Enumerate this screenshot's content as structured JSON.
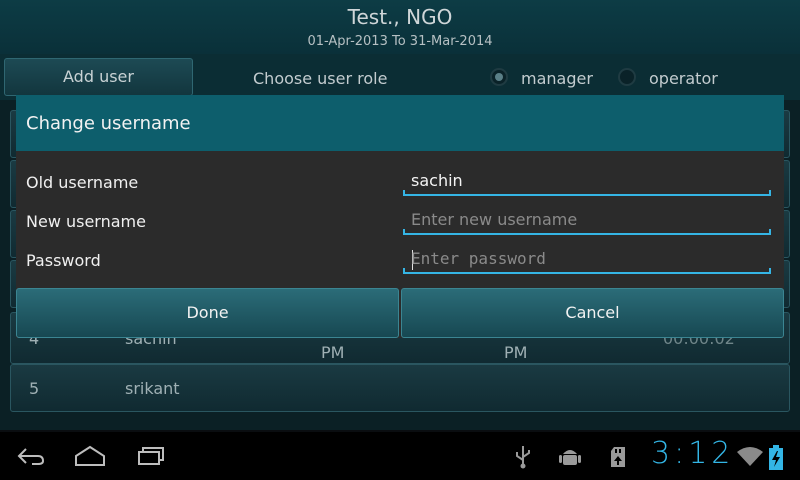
{
  "header": {
    "title": "Test., NGO",
    "subtitle": "01-Apr-2013 To 31-Mar-2014"
  },
  "toolbar": {
    "add_user_label": "Add user",
    "role_label": "Choose user role",
    "roles": [
      {
        "label": "manager",
        "selected": true
      },
      {
        "label": "operator",
        "selected": false
      }
    ]
  },
  "list": {
    "rows": [
      {
        "num": "4",
        "name": "sachin",
        "pm1": "PM",
        "pm2": "PM",
        "time": "00:00:02"
      },
      {
        "num": "5",
        "name": "srikant"
      }
    ]
  },
  "dialog": {
    "title": "Change username",
    "fields": [
      {
        "label": "Old username",
        "value": "sachin",
        "placeholder": ""
      },
      {
        "label": "New username",
        "value": "",
        "placeholder": "Enter new username"
      },
      {
        "label": "Password",
        "value": "",
        "placeholder": "Enter password"
      }
    ],
    "done_label": "Done",
    "cancel_label": "Cancel"
  },
  "statusbar": {
    "clock": "3:12",
    "icons": [
      "back-icon",
      "home-icon",
      "recent-apps-icon",
      "usb-icon",
      "android-debug-icon",
      "sd-card-icon",
      "wifi-icon",
      "battery-charging-icon"
    ]
  },
  "colors": {
    "accent": "#33b5e5",
    "dialog_title_bg": "#0d5e6c",
    "header_bg": "#0d3c45"
  }
}
